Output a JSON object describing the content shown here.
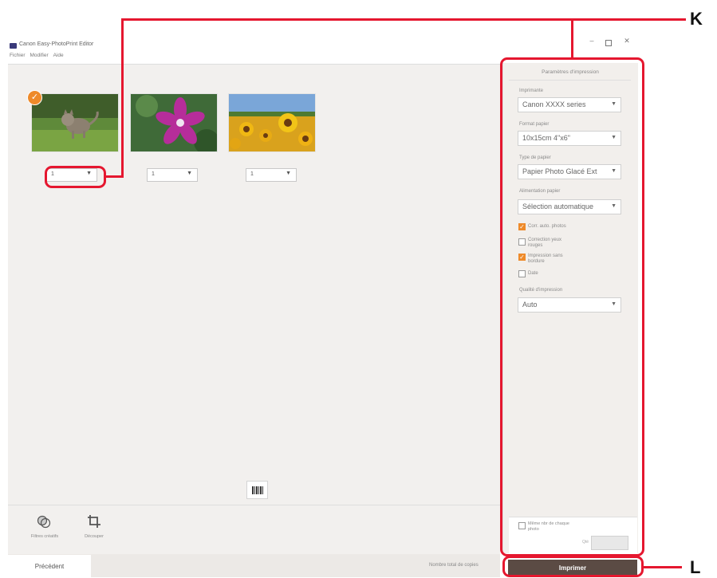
{
  "window": {
    "title": "Canon Easy-PhotoPrint Editor",
    "menu": [
      "Fichier",
      "Modifier",
      "Aide"
    ],
    "minimize": "–",
    "close": "✕"
  },
  "photos": [
    {
      "name": "Photo chat",
      "quantity": "1",
      "selected": true
    },
    {
      "name": "Photo fleur",
      "quantity": "1",
      "selected": false
    },
    {
      "name": "Photo tournesols",
      "quantity": "1",
      "selected": false
    }
  ],
  "toolbar": {
    "filters_label": "Filtres créatifs",
    "crop_label": "Découper"
  },
  "footer": {
    "previous": "Précédent",
    "total_copies_label": "Nombre total de copies",
    "print": "Imprimer"
  },
  "settings": {
    "title": "Paramètres d'impression",
    "printer_label": "Imprimante",
    "printer_value": "Canon XXXX series",
    "paper_size_label": "Format papier",
    "paper_size_value": "10x15cm 4\"x6\"",
    "media_type_label": "Type de papier",
    "media_type_value": "Papier Photo Glacé Ext",
    "paper_source_label": "Alimentation papier",
    "paper_source_value": "Sélection automatique",
    "options": [
      {
        "label": "Corr. auto. photos",
        "checked": true
      },
      {
        "label": "Correction yeux rouges",
        "checked": false
      },
      {
        "label": "Impression sans bordure",
        "checked": true
      },
      {
        "label": "Date",
        "checked": false
      }
    ],
    "quality_label": "Qualité d'impression",
    "quality_value": "Auto",
    "same_copies_label": "Même nbr de chaque photo",
    "copies_label": "Qté"
  },
  "callouts": {
    "k": "K",
    "l": "L"
  },
  "colors": {
    "accent": "#ee8a2a",
    "callout": "#e5172f",
    "print_button": "#5b4b44"
  }
}
